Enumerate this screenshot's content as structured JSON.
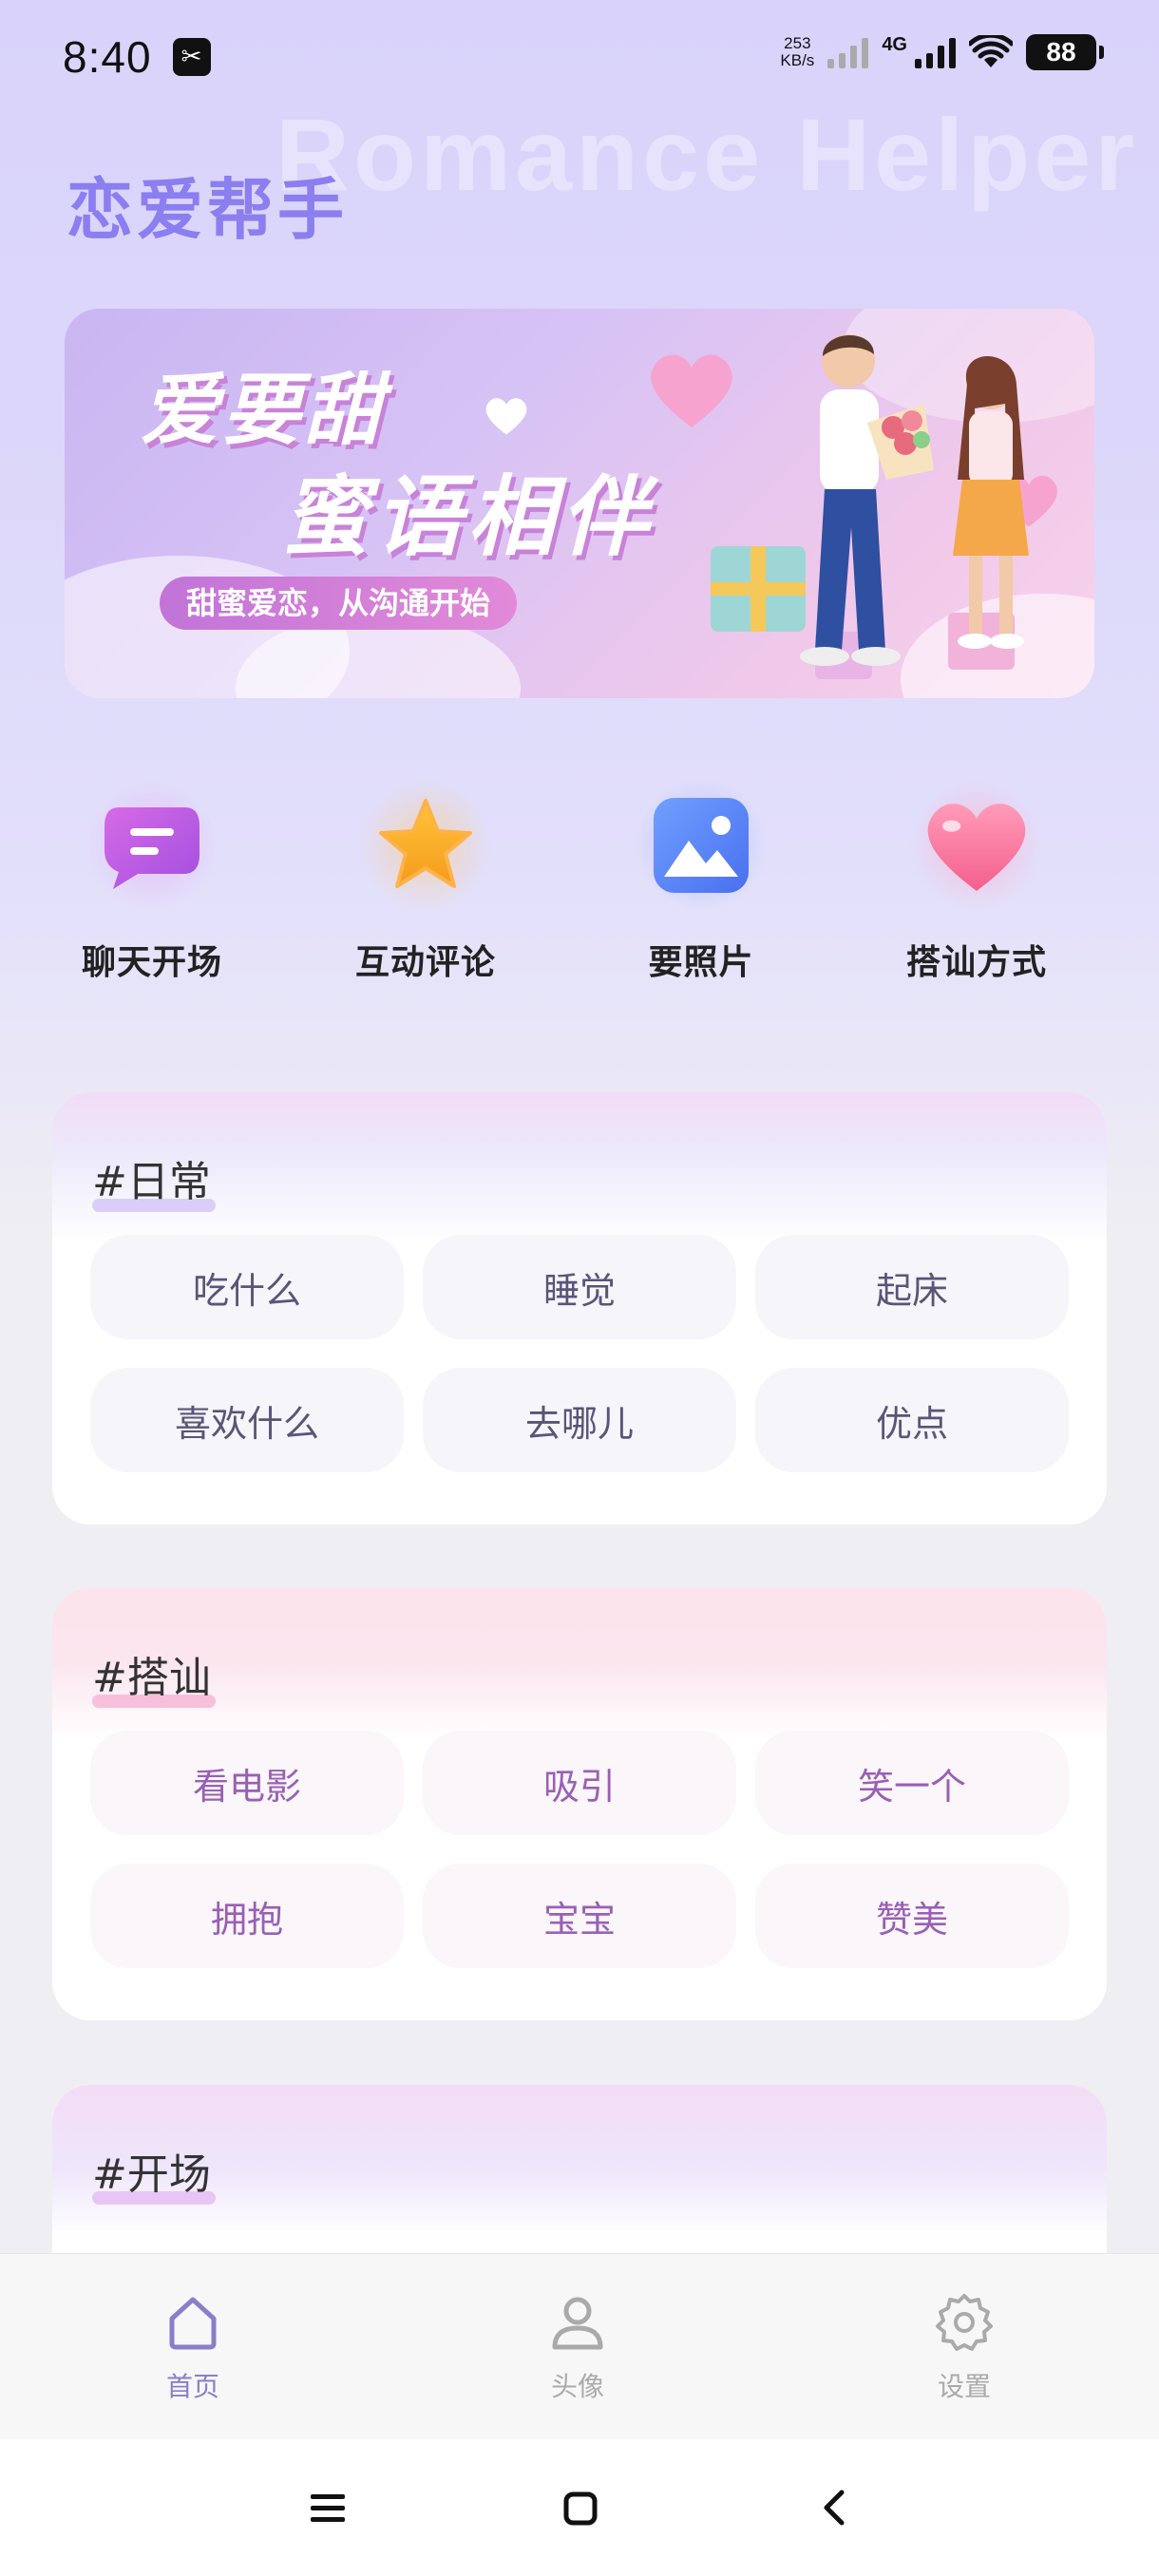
{
  "status_bar": {
    "time": "8:40",
    "app_icon": "capcut-icon",
    "net_speed_value": "253",
    "net_speed_unit": "KB/s",
    "network_type": "4G",
    "battery": "88"
  },
  "header": {
    "watermark": "Romance Helper",
    "title": "恋爱帮手"
  },
  "banner": {
    "line1": "爱要甜",
    "line2": "蜜语相伴",
    "subtitle": "甜蜜爱恋，从沟通开始"
  },
  "quick_actions": [
    {
      "label": "聊天开场",
      "icon": "chat-bubble-icon"
    },
    {
      "label": "互动评论",
      "icon": "star-icon"
    },
    {
      "label": "要照片",
      "icon": "photo-icon"
    },
    {
      "label": "搭讪方式",
      "icon": "heart-icon"
    }
  ],
  "categories": [
    {
      "title": "#日常",
      "tags": [
        "吃什么",
        "睡觉",
        "起床",
        "喜欢什么",
        "去哪儿",
        "优点"
      ]
    },
    {
      "title": "#搭讪",
      "tags": [
        "看电影",
        "吸引",
        "笑一个",
        "拥抱",
        "宝宝",
        "赞美"
      ]
    },
    {
      "title": "#开场",
      "tags": []
    }
  ],
  "bottom_nav": [
    {
      "label": "首页",
      "icon": "home-icon",
      "active": true
    },
    {
      "label": "头像",
      "icon": "user-icon",
      "active": false
    },
    {
      "label": "设置",
      "icon": "gear-icon",
      "active": false
    }
  ],
  "colors": {
    "accent": "#8b7ef0",
    "nav_active": "#8b7ec9",
    "card2_text": "#9a5fb5"
  }
}
